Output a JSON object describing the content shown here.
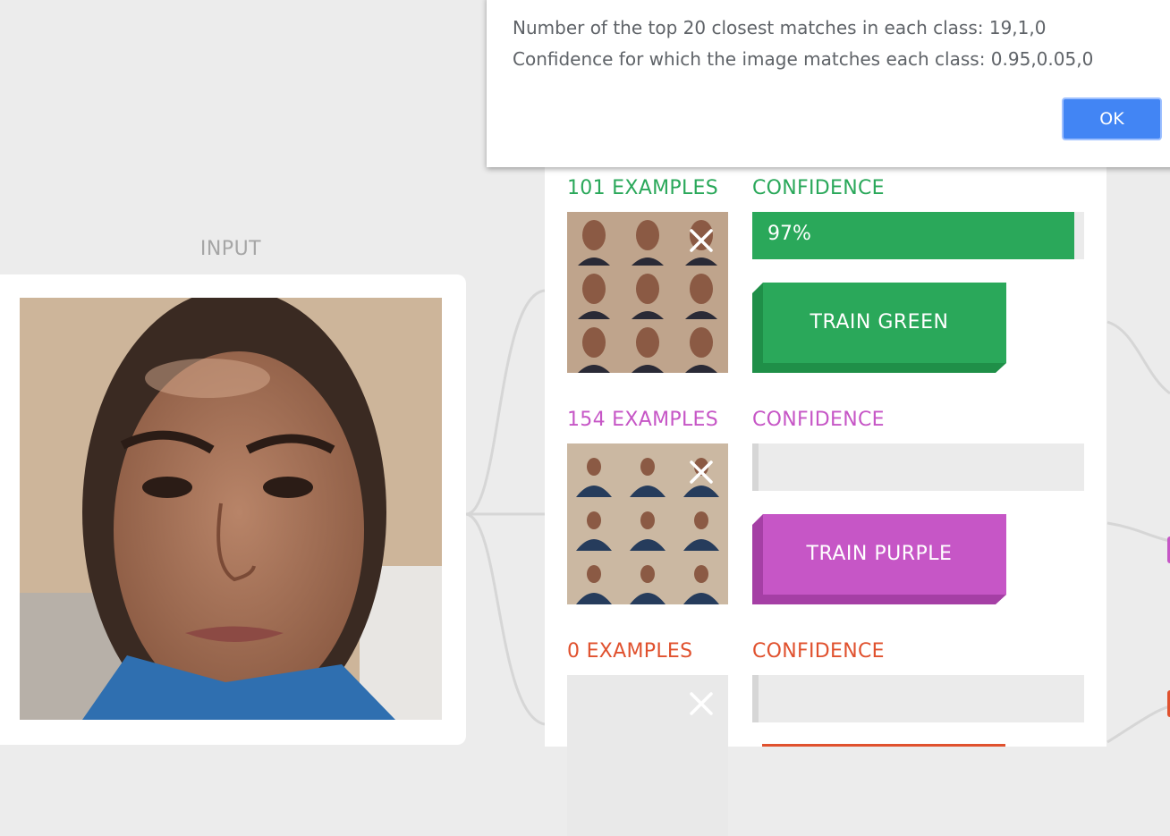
{
  "input": {
    "label": "INPUT"
  },
  "classes": [
    {
      "examples_label": "101 EXAMPLES",
      "confidence_label": "CONFIDENCE",
      "confidence_value": "97%",
      "confidence_fraction": 0.97,
      "train_label": "TRAIN GREEN",
      "color": "#2aa85a",
      "shade": "#1f8f48",
      "thumbnails_count": 9
    },
    {
      "examples_label": "154 EXAMPLES",
      "confidence_label": "CONFIDENCE",
      "confidence_value": "",
      "confidence_fraction": 0.02,
      "train_label": "TRAIN PURPLE",
      "color": "#c656c6",
      "shade": "#a53fa5",
      "thumbnails_count": 9
    },
    {
      "examples_label": "0 EXAMPLES",
      "confidence_label": "CONFIDENCE",
      "confidence_value": "",
      "confidence_fraction": 0.0,
      "train_label": "",
      "color": "#e0512e",
      "shade": "#c23f20",
      "thumbnails_count": 0
    }
  ],
  "dialog": {
    "line1": "Number of the top 20 closest matches in each class: 19,1,0",
    "line2": "Confidence for which the image matches each class: 0.95,0.05,0",
    "ok_label": "OK"
  },
  "icons": {
    "clear": "close-icon"
  }
}
